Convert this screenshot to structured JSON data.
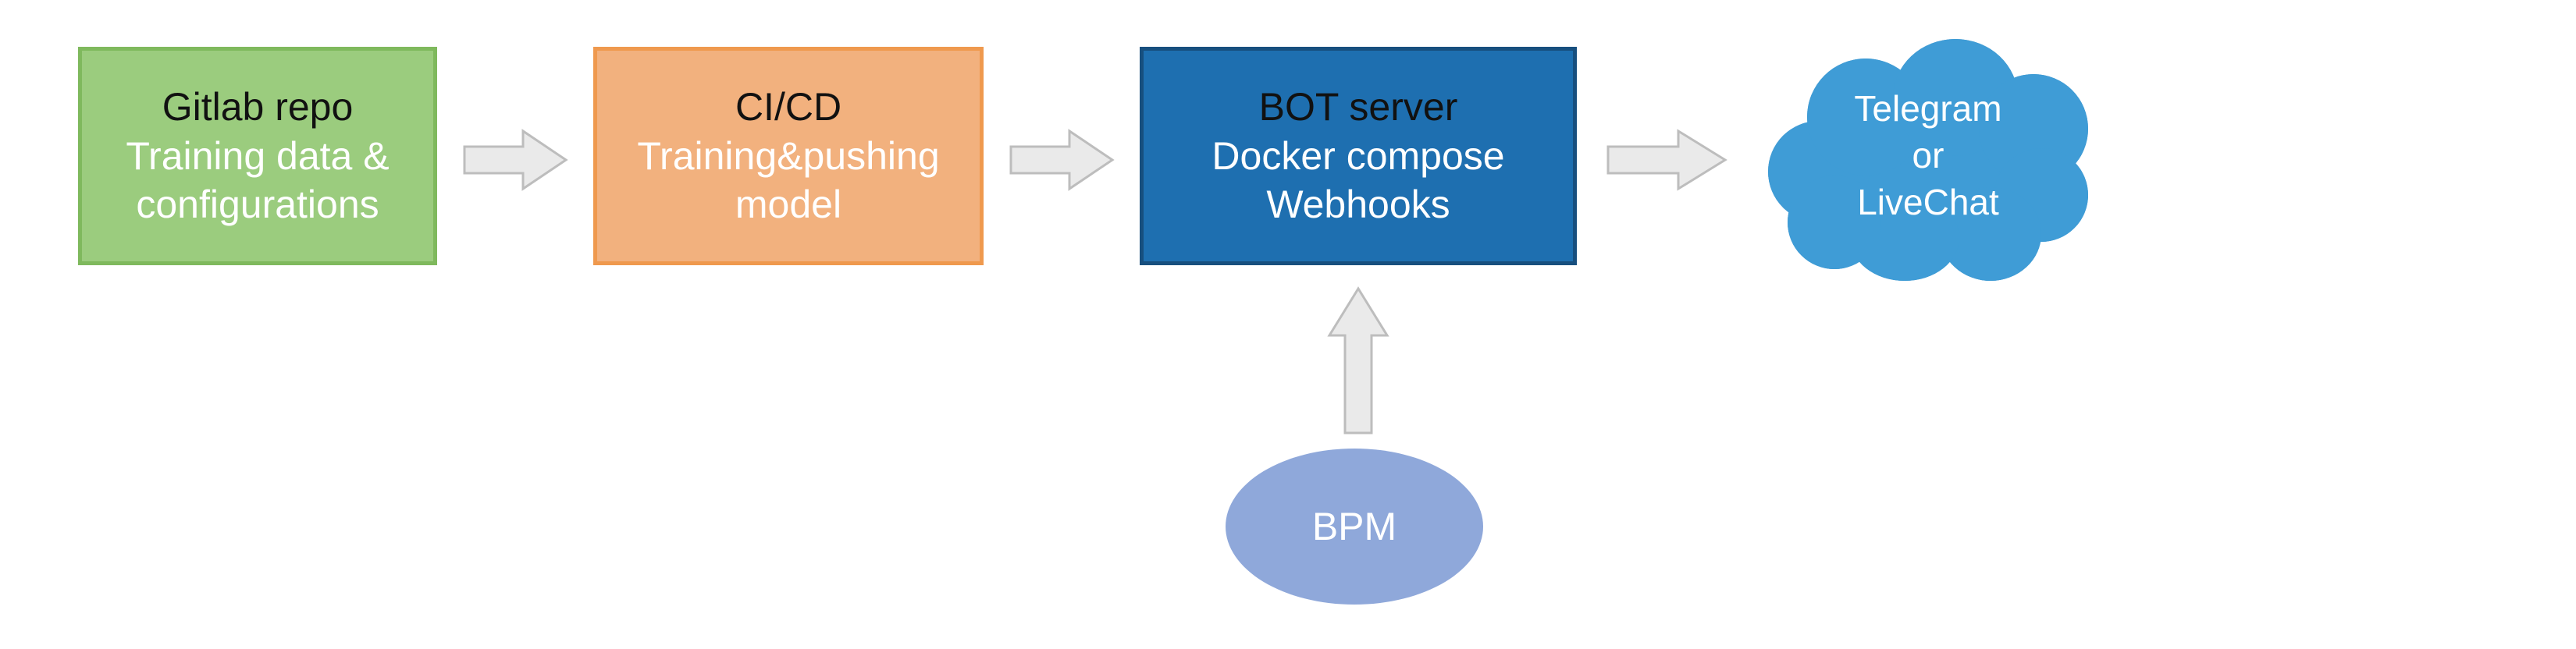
{
  "nodes": {
    "gitlab": {
      "title": "Gitlab repo",
      "subtitle1": "Training data &",
      "subtitle2": "configurations",
      "shape": "rect",
      "color": "#9bcc7e"
    },
    "cicd": {
      "title": "CI/CD",
      "subtitle1": "Training&pushing",
      "subtitle2": "model",
      "shape": "rect",
      "color": "#f2b17e"
    },
    "bot": {
      "title": "BOT server",
      "subtitle1": "Docker compose",
      "subtitle2": "Webhooks",
      "shape": "rect",
      "color": "#1e6fb0"
    },
    "bpm": {
      "label": "BPM",
      "shape": "ellipse",
      "color": "#8fa8da"
    },
    "endpoint": {
      "line1": "Telegram",
      "line2": "or",
      "line3": "LiveChat",
      "shape": "cloud",
      "color": "#3f9cd6"
    }
  },
  "arrows": [
    {
      "name": "arrow-gitlab-to-cicd",
      "from": "gitlab",
      "to": "cicd",
      "dir": "right"
    },
    {
      "name": "arrow-cicd-to-bot",
      "from": "cicd",
      "to": "bot",
      "dir": "right"
    },
    {
      "name": "arrow-bot-to-endpoint",
      "from": "bot",
      "to": "endpoint",
      "dir": "right"
    },
    {
      "name": "arrow-bpm-to-bot",
      "from": "bpm",
      "to": "bot",
      "dir": "up"
    }
  ],
  "style": {
    "arrow_fill": "#eaeaea",
    "arrow_stroke": "#bdbdbd"
  }
}
